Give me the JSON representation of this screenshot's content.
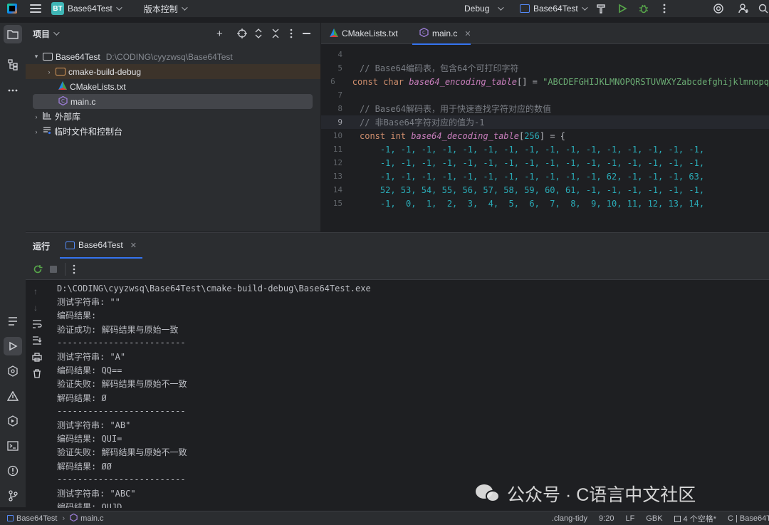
{
  "titlebar": {
    "project_badge": "BT",
    "project_name": "Base64Test",
    "vcs_label": "版本控制",
    "config_label": "Debug",
    "run_target": "Base64Test"
  },
  "project_panel": {
    "title": "项目",
    "root_name": "Base64Test",
    "root_path": "D:\\CODING\\cyyzwsq\\Base64Test",
    "items": [
      {
        "label": "cmake-build-debug"
      },
      {
        "label": "CMakeLists.txt"
      },
      {
        "label": "main.c"
      },
      {
        "label": "外部库"
      },
      {
        "label": "临时文件和控制台"
      }
    ]
  },
  "editor": {
    "tabs": [
      {
        "label": "CMakeLists.txt"
      },
      {
        "label": "main.c"
      }
    ],
    "line_numbers": [
      "4",
      "5",
      "6",
      "7",
      "8",
      "9",
      "10",
      "11",
      "12",
      "13",
      "14",
      "15"
    ],
    "line5": "// Base64编码表，包含64个可打印字符",
    "line6_kw": "const char ",
    "line6_fn": "base64_encoding_table",
    "line6_pl": "[] = ",
    "line6_str": "\"ABCDEFGHIJKLMNOPQRSTUVWXYZabcdefghijklmnopq",
    "line8": "// Base64解码表，用于快速查找字符对应的数值",
    "line9": "// 非Base64字符对应的值为-1",
    "line10_kw": "const int ",
    "line10_fn": "base64_decoding_table",
    "line10_pl1": "[",
    "line10_num": "256",
    "line10_pl2": "] = {",
    "line11": "    -1, -1, -1, -1, -1, -1, -1, -1, -1, -1, -1, -1, -1, -1, -1, -1,",
    "line12": "    -1, -1, -1, -1, -1, -1, -1, -1, -1, -1, -1, -1, -1, -1, -1, -1,",
    "line13": "    -1, -1, -1, -1, -1, -1, -1, -1, -1, -1, -1, 62, -1, -1, -1, 63,",
    "line14": "    52, 53, 54, 55, 56, 57, 58, 59, 60, 61, -1, -1, -1, -1, -1, -1,",
    "line15": "    -1,  0,  1,  2,  3,  4,  5,  6,  7,  8,  9, 10, 11, 12, 13, 14,"
  },
  "run_panel": {
    "title": "运行",
    "tab_label": "Base64Test",
    "console_lines": [
      "D:\\CODING\\cyyzwsq\\Base64Test\\cmake-build-debug\\Base64Test.exe",
      "测试字符串: \"\"",
      "编码结果: ",
      "验证成功: 解码结果与原始一致",
      "-------------------------",
      "测试字符串: \"A\"",
      "编码结果: QQ==",
      "验证失败: 解码结果与原始不一致",
      "解码结果: Ø",
      "-------------------------",
      "测试字符串: \"AB\"",
      "编码结果: QUI=",
      "验证失败: 解码结果与原始不一致",
      "解码结果: ØØ",
      "-------------------------",
      "测试字符串: \"ABC\"",
      "编码结果: QUJD"
    ]
  },
  "statusbar": {
    "crumb_project": "Base64Test",
    "crumb_file": "main.c",
    "linter": ".clang-tidy",
    "position": "9:20",
    "line_ending": "LF",
    "encoding": "GBK",
    "indent": "4 个空格*",
    "context": "C | Base64T"
  },
  "watermark": {
    "text": "公众号 · C语言中文社区"
  }
}
